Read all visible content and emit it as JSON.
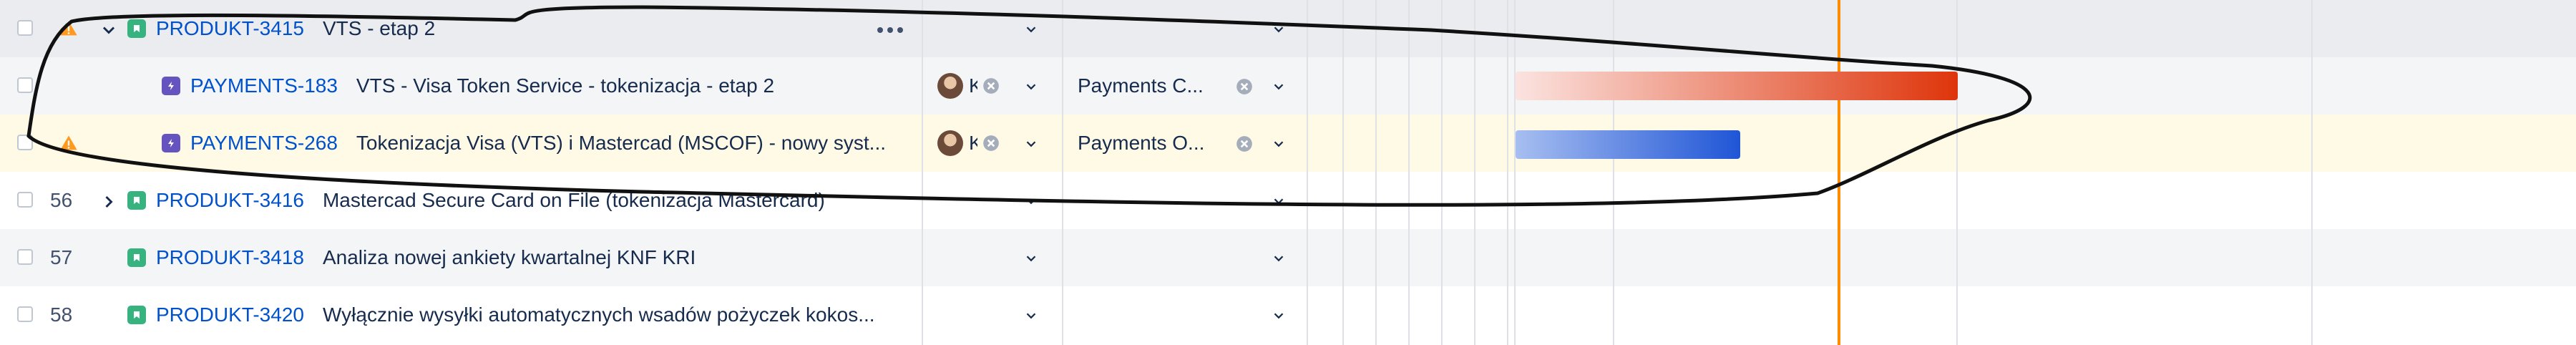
{
  "rows": [
    {
      "num": "",
      "expanded": true,
      "warning": true,
      "type": "story",
      "key": "PRODUKT-3415",
      "summary": "VTS - etap 2",
      "has_actions": true,
      "team": ""
    },
    {
      "num": "",
      "warning": false,
      "type": "epic",
      "key": "PAYMENTS-183",
      "summary": "VTS - Visa Token Service - tokenizacja - etap 2",
      "assignee_initial": "K",
      "team": "Payments C..."
    },
    {
      "num": "",
      "warning": true,
      "type": "epic",
      "key": "PAYMENTS-268",
      "summary": "Tokenizacja Visa (VTS) i Mastercad (MSCOF) - nowy syst...",
      "assignee_initial": "K",
      "team": "Payments O..."
    },
    {
      "num": "56",
      "expanded": false,
      "type": "story",
      "key": "PRODUKT-3416",
      "summary": "Mastercad Secure Card on File (tokenizacja Mastercard)",
      "team": ""
    },
    {
      "num": "57",
      "type": "story",
      "key": "PRODUKT-3418",
      "summary": "Analiza nowej ankiety kwartalnej KNF KRI",
      "team": ""
    },
    {
      "num": "58",
      "type": "story",
      "key": "PRODUKT-3420",
      "summary": "Wyłącznie wysyłki automatycznych wsadów pożyczek kokos...",
      "team": ""
    }
  ],
  "timeline": {
    "today_marker_color": "#ff8b00",
    "bars": [
      {
        "row": 1,
        "start_color": "#fbe3e0",
        "end_color": "#de350b"
      },
      {
        "row": 2,
        "start_color": "#a7bef0",
        "end_color": "#1f55d6"
      }
    ]
  },
  "colors": {
    "selected_row": "#ebecf0",
    "child_row": "#f4f5f7",
    "highlight_row": "#fffae6",
    "link": "#0052cc"
  }
}
